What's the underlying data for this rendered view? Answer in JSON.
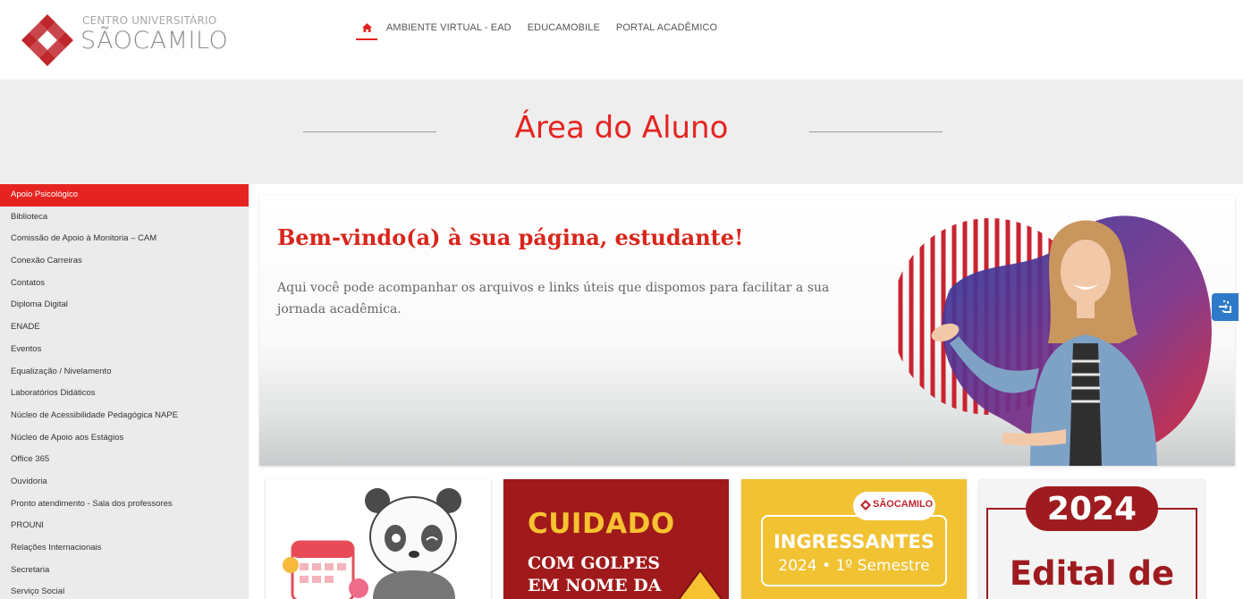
{
  "header": {
    "logo_small": "CENTRO UNIVERSITÁRIO",
    "logo_big": "SÃOCAMILO",
    "nav": {
      "home_icon": "home-icon",
      "items": [
        "AMBIENTE VIRTUAL - EAD",
        "EDUCAMOBILE",
        "PORTAL ACADÊMICO"
      ]
    }
  },
  "banner": {
    "title": "Área do Aluno"
  },
  "sidebar": {
    "items": [
      "Apoio Psicológico",
      "Biblioteca",
      "Comissão de Apoio à Monitoria – CAM",
      "Conexão Carreiras",
      "Contatos",
      "Diploma Digital",
      "ENADE",
      "Eventos",
      "Equalização / Nivelamento",
      "Laboratórios Didáticos",
      "Núcleo de Acessibilidade Pedagógica NAPE",
      "Núcleo de Apoio aos Estágios",
      "Office 365",
      "Ouvidoria",
      "Pronto atendimento - Sala dos professores",
      "PROUNI",
      "Relações Internacionais",
      "Secretaria",
      "Serviço Social"
    ],
    "active_index": 0
  },
  "hero": {
    "title": "Bem-vindo(a) à sua página, estudante!",
    "text": "Aqui você pode acompanhar os arquivos e links úteis que dispomos para facilitar a sua jornada acadêmica."
  },
  "cards": {
    "card2_line1": "CUIDADO",
    "card2_line2": "COM GOLPES",
    "card2_line3": "EM NOME DA",
    "card3_logo": "SÃOCAMILO",
    "card3_line1": "INGRESSANTES",
    "card3_line2": "2024 • 1º Semestre",
    "card4_year": "2024",
    "card4_text": "Edital de"
  },
  "colors": {
    "brand_red": "#e52421",
    "banner_bg": "#eeeeee",
    "sidebar_bg": "#ebebeb",
    "a11y_blue": "#2e7ac8"
  }
}
